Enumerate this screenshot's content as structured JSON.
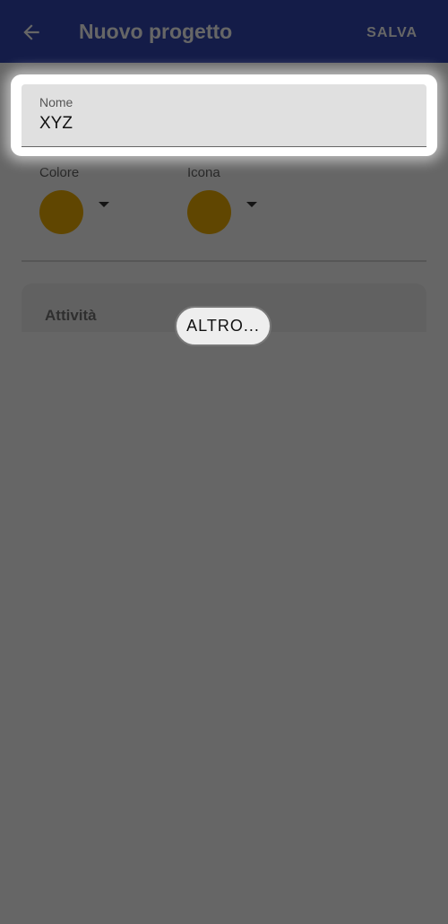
{
  "appbar": {
    "title": "Nuovo progetto",
    "save_label": "SALVA",
    "back_icon": "arrow-back-icon"
  },
  "form": {
    "name_label": "Nome",
    "name_value": "XYZ",
    "color_label": "Colore",
    "color_value": "#f1ae03",
    "icon_label": "Icona",
    "icon_value": "#f1ae03"
  },
  "activities": {
    "title": "Attività",
    "more_button": "ALTRO..."
  },
  "colors": {
    "primary": "#3347b5",
    "accent": "#f1ae03"
  }
}
